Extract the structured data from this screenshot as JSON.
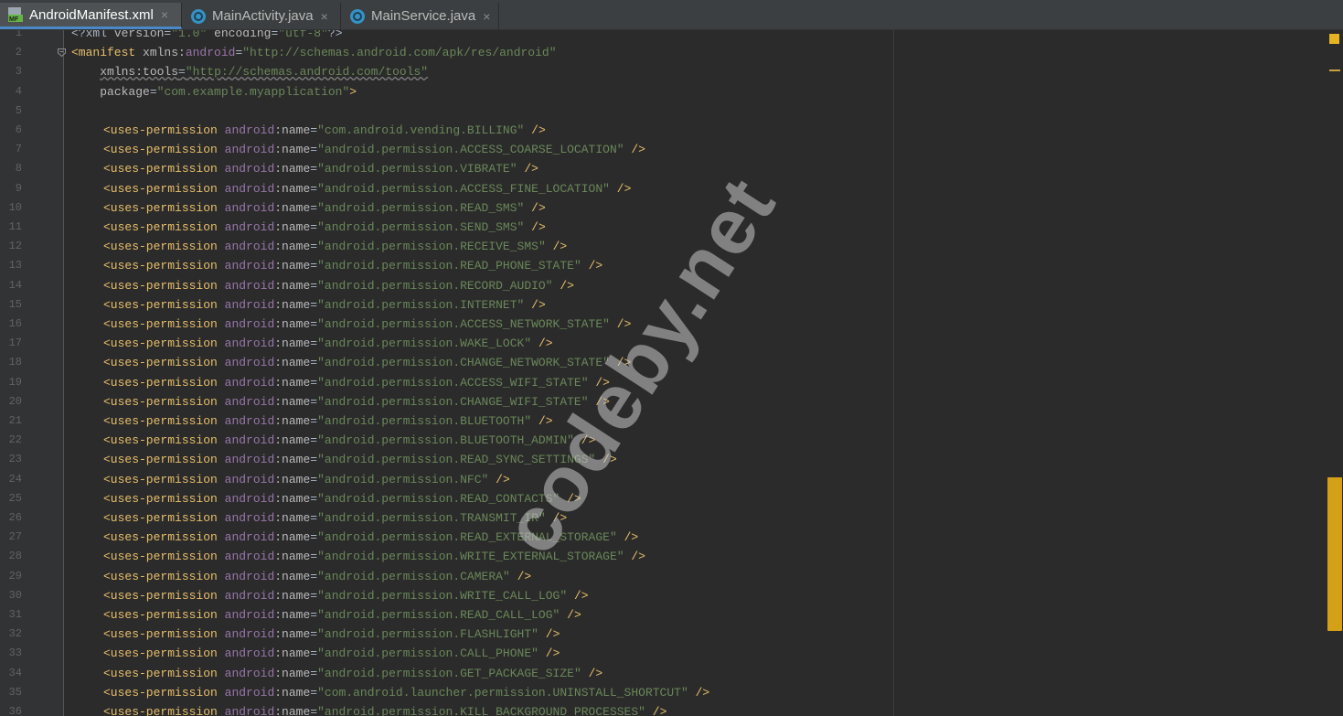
{
  "tabs": [
    {
      "label": "AndroidManifest.xml",
      "icon": "manifest-file-icon",
      "active": true,
      "close": "×"
    },
    {
      "label": "MainActivity.java",
      "icon": "java-class-icon",
      "active": false,
      "close": "×"
    },
    {
      "label": "MainService.java",
      "icon": "java-class-icon",
      "active": false,
      "close": "×"
    }
  ],
  "header_lines": [
    {
      "num": "1",
      "segs": [
        [
          "p",
          "<?xml "
        ],
        [
          "a",
          "version"
        ],
        [
          "p",
          "="
        ],
        [
          "v",
          "\"1.0\""
        ],
        [
          "p",
          " "
        ],
        [
          "a",
          "encoding"
        ],
        [
          "p",
          "="
        ],
        [
          "v",
          "\"utf-8\""
        ],
        [
          "p",
          "?>"
        ]
      ]
    },
    {
      "num": "2",
      "segs": [
        [
          "t",
          "<manifest "
        ],
        [
          "a",
          "xmlns:"
        ],
        [
          "an",
          "android"
        ],
        [
          "p",
          "="
        ],
        [
          "v",
          "\"http://schemas.android.com/apk/res/android\""
        ]
      ]
    },
    {
      "num": "3",
      "segs": [
        [
          "p",
          "    "
        ],
        [
          "a",
          "xmlns:tools",
          "wavy"
        ],
        [
          "p",
          "=",
          "wavy"
        ],
        [
          "v",
          "\"http://schemas.android.com/tools\"",
          "wavy"
        ]
      ]
    },
    {
      "num": "4",
      "segs": [
        [
          "p",
          "    "
        ],
        [
          "a",
          "package"
        ],
        [
          "p",
          "="
        ],
        [
          "v",
          "\"com.example.myapplication\""
        ],
        [
          "t",
          ">"
        ]
      ]
    },
    {
      "num": "5",
      "segs": []
    }
  ],
  "permission_tag": "<uses-permission",
  "namespace": "android",
  "attr": ":name",
  "close_tag": "/>",
  "permissions": [
    "com.android.vending.BILLING",
    "android.permission.ACCESS_COARSE_LOCATION",
    "android.permission.VIBRATE",
    "android.permission.ACCESS_FINE_LOCATION",
    "android.permission.READ_SMS",
    "android.permission.SEND_SMS",
    "android.permission.RECEIVE_SMS",
    "android.permission.READ_PHONE_STATE",
    "android.permission.RECORD_AUDIO",
    "android.permission.INTERNET",
    "android.permission.ACCESS_NETWORK_STATE",
    "android.permission.WAKE_LOCK",
    "android.permission.CHANGE_NETWORK_STATE",
    "android.permission.ACCESS_WIFI_STATE",
    "android.permission.CHANGE_WIFI_STATE",
    "android.permission.BLUETOOTH",
    "android.permission.BLUETOOTH_ADMIN",
    "android.permission.READ_SYNC_SETTINGS",
    "android.permission.NFC",
    "android.permission.READ_CONTACTS",
    "android.permission.TRANSMIT_IR",
    "android.permission.READ_EXTERNAL_STORAGE",
    "android.permission.WRITE_EXTERNAL_STORAGE",
    "android.permission.CAMERA",
    "android.permission.WRITE_CALL_LOG",
    "android.permission.READ_CALL_LOG",
    "android.permission.FLASHLIGHT",
    "android.permission.CALL_PHONE",
    "android.permission.GET_PACKAGE_SIZE",
    "com.android.launcher.permission.UNINSTALL_SHORTCUT",
    "android.permission.KILL_BACKGROUND_PROCESSES"
  ],
  "permission_start_line": 6,
  "watermark": "codeby.net",
  "colors": {
    "background": "#2b2b2b",
    "tag": "#e8bf6a",
    "namespace": "#9876aa",
    "attribute": "#bababa",
    "value": "#6a8759",
    "scroll_thumb": "#d4a017"
  }
}
